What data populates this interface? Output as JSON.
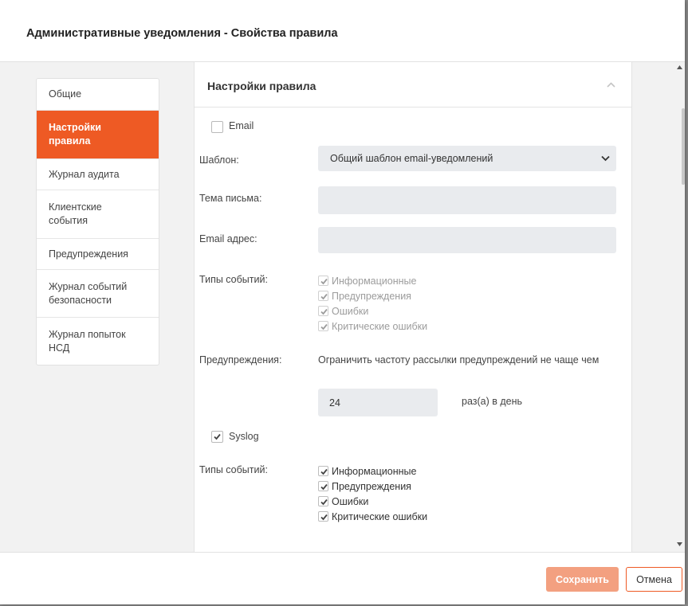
{
  "dialog": {
    "title": "Административные уведомления - Свойства правила"
  },
  "nav": {
    "items": [
      {
        "label": "Общие"
      },
      {
        "label": "Настройки правила"
      },
      {
        "label": "Журнал аудита"
      },
      {
        "label": "Клиентские события"
      },
      {
        "label": "Предупреждения"
      },
      {
        "label": "Журнал событий безопасности"
      },
      {
        "label": "Журнал попыток НСД"
      }
    ],
    "active_index": 1
  },
  "panel": {
    "title": "Настройки правила",
    "email": {
      "label": "Email",
      "checked": false,
      "template_label": "Шаблон:",
      "template_value": "Общий шаблон email-уведомлений",
      "subject_label": "Тема письма:",
      "subject_value": "",
      "address_label": "Email адрес:",
      "address_value": "",
      "event_types_label": "Типы событий:",
      "event_types": [
        {
          "label": "Информационные",
          "checked": true
        },
        {
          "label": "Предупреждения",
          "checked": true
        },
        {
          "label": "Ошибки",
          "checked": true
        },
        {
          "label": "Критические ошибки",
          "checked": true
        }
      ],
      "warnings_label": "Предупреждения:",
      "warnings_text": "Ограничить частоту рассылки предупреждений не чаще чем",
      "warnings_value": "24",
      "warnings_unit": "раз(а) в день"
    },
    "syslog": {
      "label": "Syslog",
      "checked": true,
      "event_types_label": "Типы событий:",
      "event_types": [
        {
          "label": "Информационные",
          "checked": true
        },
        {
          "label": "Предупреждения",
          "checked": true
        },
        {
          "label": "Ошибки",
          "checked": true
        },
        {
          "label": "Критические ошибки",
          "checked": true
        }
      ]
    }
  },
  "footer": {
    "save_label": "Сохранить",
    "cancel_label": "Отмена"
  },
  "colors": {
    "accent": "#ee5a24",
    "save_disabled": "#f3a080",
    "field_bg": "#e9ebee"
  },
  "icons": {
    "check": "checkmark-icon",
    "collapse": "chevron-up-icon",
    "dropdown": "chevron-down-icon"
  }
}
